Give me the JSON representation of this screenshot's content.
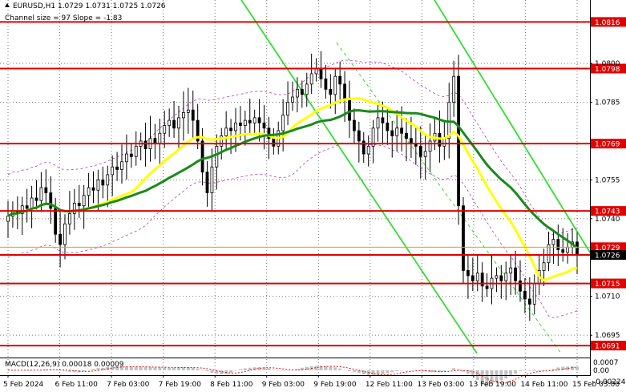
{
  "header": {
    "symbol_line": "EURUSD,H1  1.0729 1.0731 1.0725 1.0726",
    "channel_line": "Channel size = 97  Slope = -1.83"
  },
  "macd": {
    "label": "MACD(12,26,9) 0.00018 0.00009"
  },
  "colors": {
    "level_line": "#e00000",
    "level_tag_bg": "#e00000",
    "level_tag_text": "#ffffff",
    "grid": "#000000",
    "candle": "#000000",
    "ma_fast": "#ffff00",
    "ma_slow": "#1a8a1a",
    "channel": "#33dd33",
    "envelope": "#b040b0",
    "macd_hist": "#c0c0c0",
    "macd_signal": "#e00000",
    "current_price_line": "#e6a000"
  },
  "chart_data": {
    "type": "candlestick",
    "symbol": "EURUSD",
    "timeframe": "H1",
    "ohlc_last": {
      "open": 1.0729,
      "high": 1.0731,
      "low": 1.0725,
      "close": 1.0726
    },
    "price_axis": {
      "ylim": [
        1.0687,
        1.0822
      ],
      "ticks": [
        "1.0800",
        "1.0785",
        "1.0755",
        "1.0740",
        "1.0710",
        "1.0695"
      ]
    },
    "levels": [
      "1.0816",
      "1.0798",
      "1.0769",
      "1.0743",
      "1.0729",
      "1.0726",
      "1.0715",
      "1.0691"
    ],
    "current_price": "1.0726",
    "x_axis": {
      "ticks": [
        "5 Feb 2024",
        "6 Feb 11:00",
        "7 Feb 03:00",
        "7 Feb 19:00",
        "8 Feb 11:00",
        "9 Feb 03:00",
        "9 Feb 19:00",
        "12 Feb 11:00",
        "13 Feb 03:00",
        "13 Feb 19:00",
        "14 Feb 11:00",
        "15 Feb 03:00"
      ]
    },
    "macd_axis": {
      "ylim": [
        -0.00024,
        0.0008
      ],
      "ticks": [
        "0.0007",
        "0.00",
        "-0.00224"
      ]
    },
    "close_series": [
      1.0741,
      1.0743,
      1.0742,
      1.0745,
      1.0744,
      1.0748,
      1.0747,
      1.0752,
      1.075,
      1.0744,
      1.0734,
      1.073,
      1.0738,
      1.0742,
      1.0746,
      1.0745,
      1.0749,
      1.0752,
      1.0751,
      1.0755,
      1.0753,
      1.0757,
      1.076,
      1.0759,
      1.0762,
      1.0765,
      1.0764,
      1.0768,
      1.077,
      1.0767,
      1.0771,
      1.0769,
      1.0773,
      1.0776,
      1.0778,
      1.0775,
      1.0779,
      1.0781,
      1.0782,
      1.0778,
      1.077,
      1.0758,
      1.075,
      1.076,
      1.0768,
      1.0772,
      1.0775,
      1.0774,
      1.0777,
      1.0776,
      1.0778,
      1.0777,
      1.0779,
      1.0777,
      1.0775,
      1.0771,
      1.0768,
      1.0774,
      1.078,
      1.0785,
      1.0787,
      1.079,
      1.0788,
      1.0792,
      1.0796,
      1.0798,
      1.0794,
      1.079,
      1.0788,
      1.0795,
      1.0792,
      1.0786,
      1.0778,
      1.0774,
      1.077,
      1.0765,
      1.0768,
      1.0775,
      1.0779,
      1.0777,
      1.0774,
      1.0772,
      1.0775,
      1.0773,
      1.0771,
      1.0769,
      1.0768,
      1.0764,
      1.0766,
      1.077,
      1.0773,
      1.0768,
      1.0771,
      1.0785,
      1.0795,
      1.0745,
      1.072,
      1.0718,
      1.0716,
      1.0719,
      1.0714,
      1.0713,
      1.0717,
      1.0718,
      1.0716,
      1.0719,
      1.0721,
      1.0716,
      1.0712,
      1.0709,
      1.0707,
      1.0715,
      1.072,
      1.0723,
      1.073,
      1.0732,
      1.0728,
      1.0727,
      1.0729,
      1.0731,
      1.0726
    ]
  }
}
